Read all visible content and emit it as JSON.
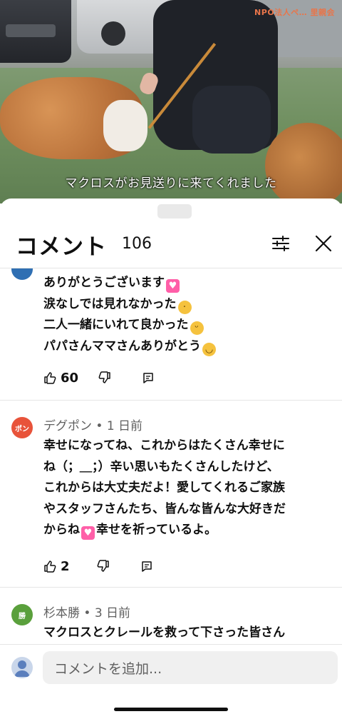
{
  "video": {
    "caption": "マクロスがお見送りに来てくれました",
    "watermark": "NPO法人ペ… 里親会"
  },
  "sheet": {
    "title": "コメント",
    "count": "106",
    "filter_icon": "tune-icon",
    "close_icon": "close-icon"
  },
  "comments": [
    {
      "author_meta": "",
      "lines": [
        {
          "text": "ありがとうございます",
          "emoji": "heart-emoji"
        },
        {
          "text": "涙なしでは見れなかった",
          "emoji": "crying-face-emoji"
        },
        {
          "text": "二人一緒にいれて良かった",
          "emoji": "laughing-tears-emoji"
        },
        {
          "text": "パパさんママさんありがとう",
          "emoji": "smiling-face-emoji"
        }
      ],
      "likes": "60"
    },
    {
      "avatar_text": "ポン",
      "avatar_color": "#e8533a",
      "author_meta": "デグポン • 1 日前",
      "lines": [
        {
          "text": "幸せになってね、これからはたくさん幸せに"
        },
        {
          "text": "ね（；＿；）辛い思いもたくさんしたけど、"
        },
        {
          "text": "これからは大丈夫だよ！愛してくれるご家族"
        },
        {
          "text": "やスタッフさんたち、皆んな皆んな大好きだ"
        },
        {
          "text": "からね",
          "emoji_mid": "heart-emoji",
          "after": "幸せを祈っているよ。"
        }
      ],
      "likes": "2"
    },
    {
      "avatar_text": "勝",
      "avatar_color": "#5aa03c",
      "author_meta": "杉本勝 • 3 日前",
      "lines": [
        {
          "text": "マクロスとクレールを救って下さった皆さん"
        }
      ]
    }
  ],
  "add_comment": {
    "placeholder": "コメントを追加..."
  },
  "colors": {
    "accent_red": "#ff0000",
    "divider": "#e5e5e5",
    "secondary_text": "#606060"
  }
}
